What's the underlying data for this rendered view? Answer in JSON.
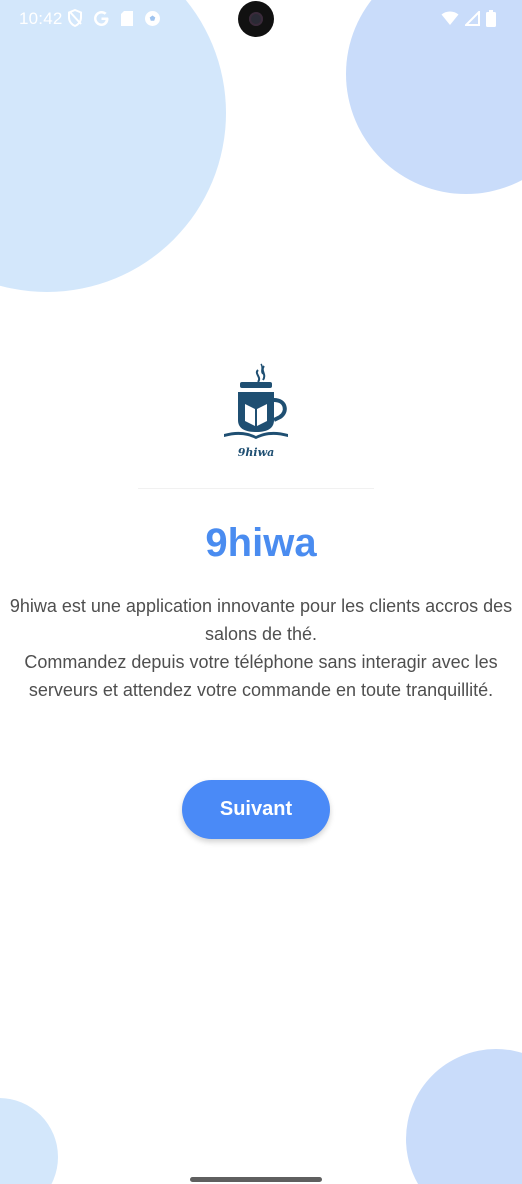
{
  "status_bar": {
    "time": "10:42",
    "left_icons": [
      "vpn-shield-icon",
      "google-icon",
      "sd-card-icon",
      "soccer-ball-icon"
    ],
    "right_icons": [
      "wifi-icon",
      "cellular-signal-icon",
      "battery-icon"
    ]
  },
  "colors": {
    "accent": "#4a8af7",
    "title": "#4a8cf0",
    "blob_light": "#d3e7fb",
    "blob_blue": "#c9dcfa"
  },
  "logo": {
    "icon": "tea-cup-book-logo",
    "caption": "9hiwa"
  },
  "title": "9hiwa",
  "description": {
    "line1": "9hiwa est une application innovante pour les clients accros des salons de thé.",
    "line2": "Commandez depuis votre téléphone sans interagir avec les serveurs et attendez votre commande en toute tranquillité."
  },
  "next_button": {
    "label": "Suivant"
  }
}
